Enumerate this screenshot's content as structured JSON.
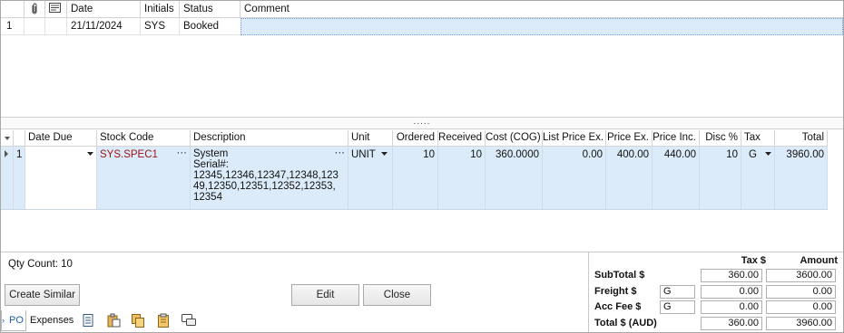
{
  "history": {
    "headers": {
      "attach": "",
      "note": "",
      "date": "Date",
      "initials": "Initials",
      "status": "Status",
      "comment": "Comment"
    },
    "rows": [
      {
        "num": "1",
        "date": "21/11/2024",
        "initials": "SYS",
        "status": "Booked",
        "comment": ""
      }
    ]
  },
  "splitter": ".....",
  "lines": {
    "headers": {
      "date_due": "Date Due",
      "stock_code": "Stock Code",
      "description": "Description",
      "unit": "Unit",
      "ordered": "Ordered",
      "received": "Received",
      "cost": "Cost (COG)",
      "list_price_ex": "List Price Ex.",
      "price_ex": "Price Ex.",
      "price_inc": "Price Inc.",
      "disc": "Disc %",
      "tax": "Tax",
      "total": "Total"
    },
    "rows": [
      {
        "num": "1",
        "date_due": "",
        "stock_code": "SYS.SPEC1",
        "description": [
          "System",
          "Serial#:",
          "12345,12346,12347,12348,123",
          "49,12350,12351,12352,12353,",
          "12354"
        ],
        "unit": "UNIT",
        "ordered": "10",
        "received": "10",
        "cost": "360.0000",
        "list_price_ex": "0.00",
        "price_ex": "400.00",
        "price_inc": "440.00",
        "disc": "10",
        "tax": "G",
        "total": "3960.00"
      }
    ]
  },
  "qty_count": "Qty Count: 10",
  "buttons": {
    "create_similar": "Create Similar",
    "edit": "Edit",
    "close": "Close"
  },
  "tabs": {
    "po": "PO",
    "expenses": "Expenses"
  },
  "totals": {
    "col_tax": "Tax $",
    "col_amount": "Amount",
    "subtotal_label": "SubTotal $",
    "subtotal_tax": "360.00",
    "subtotal_amount": "3600.00",
    "freight_label": "Freight $",
    "freight_code": "G",
    "freight_tax": "0.00",
    "freight_amount": "0.00",
    "accfee_label": "Acc Fee $",
    "accfee_code": "G",
    "accfee_tax": "0.00",
    "accfee_amount": "0.00",
    "total_label": "Total $ (AUD)",
    "total_tax": "360.00",
    "total_amount": "3960.00"
  },
  "colors": {
    "selection": "#dcebf9",
    "code_text": "#9b1111",
    "focus_border": "#6e9dd8"
  }
}
